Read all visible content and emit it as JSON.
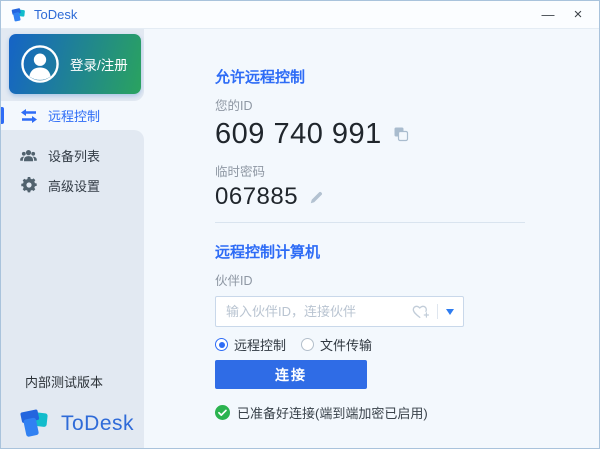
{
  "titlebar": {
    "title": "ToDesk",
    "minimize": "—",
    "close": "×"
  },
  "sidebar": {
    "login_label": "登录/注册",
    "nav": [
      {
        "label": "远程控制",
        "active": true
      },
      {
        "label": "设备列表",
        "active": false
      },
      {
        "label": "高级设置",
        "active": false
      }
    ],
    "footer": {
      "version": "内部测试版本",
      "brand": "ToDesk"
    }
  },
  "main": {
    "allow": {
      "title": "允许远程控制",
      "id_label": "您的ID",
      "id_value": "609 740 991",
      "password_label": "临时密码",
      "password_value": "067885"
    },
    "connect": {
      "title": "远程控制计算机",
      "partner_label": "伙伴ID",
      "input_placeholder": "输入伙伴ID，连接伙伴",
      "input_value": "",
      "modes": [
        {
          "label": "远程控制",
          "selected": true
        },
        {
          "label": "文件传输",
          "selected": false
        }
      ],
      "button": "连接",
      "status": "已准备好连接(端到端加密已启用)"
    }
  },
  "icons": {
    "todesk-logo-icon": "blue-teal overlapping squares mark",
    "avatar-icon": "white person silhouette in circle",
    "transfer-arrows-icon": "two opposing horizontal arrows",
    "devices-people-icon": "group of three people",
    "gear-icon": "cog wheel",
    "copy-icon": "two overlapping squares",
    "edit-pencil-icon": "pencil",
    "heart-plus-icon": "heart outline with plus",
    "chevron-down-icon": "triangle-down",
    "check-circle-icon": "white check in green circle",
    "minimize-icon": "—",
    "close-icon": "×"
  },
  "colors": {
    "accent_blue": "#2e6cf6",
    "button_blue": "#2f6ce6",
    "title_text_blue": "#2e6bd6",
    "success_green": "#2bb34f",
    "card_gradient_start": "#1563c7",
    "card_gradient_end": "#2aa35f",
    "sidebar_bg": "#e2e9f2",
    "main_bg": "#f3f8fd",
    "titlebar_bg": "#fbfdff"
  }
}
